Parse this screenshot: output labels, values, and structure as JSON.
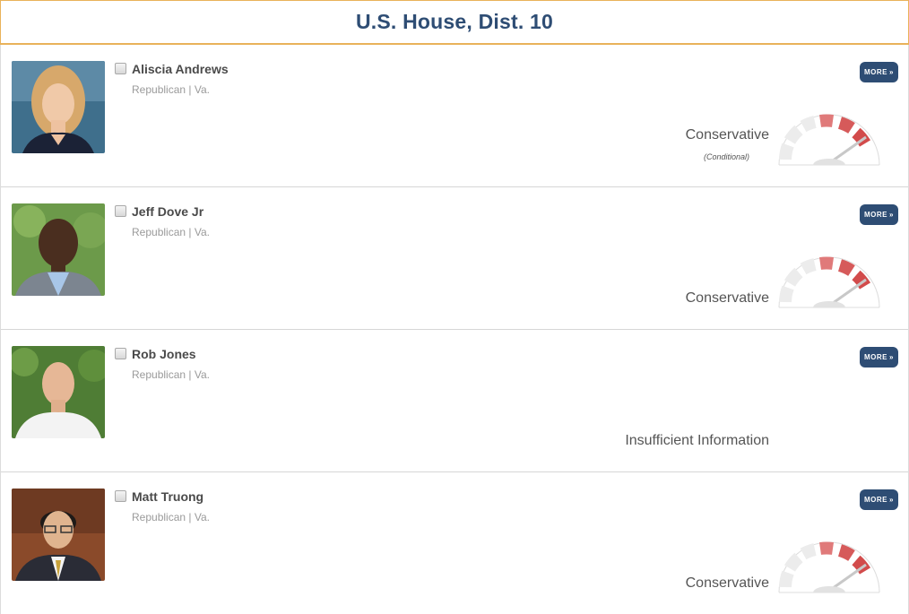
{
  "header": {
    "title": "U.S. House, Dist. 10"
  },
  "more_label": "MORE",
  "colors": {
    "accent": "#2e4d74",
    "border_gold": "#e9b25a",
    "gauge_red_light": "#e07a7a",
    "gauge_red": "#d24b4b",
    "gauge_gray": "#ececec"
  },
  "candidates": [
    {
      "name": "Aliscia Andrews",
      "party": "Republican | Va.",
      "rating": "Conservative",
      "rating_note": "(Conditional)",
      "gauge": true,
      "photo": "woman-blonde-portrait"
    },
    {
      "name": "Jeff Dove Jr",
      "party": "Republican | Va.",
      "rating": "Conservative",
      "rating_note": "",
      "gauge": true,
      "photo": "man-suit-outdoor-portrait"
    },
    {
      "name": "Rob Jones",
      "party": "Republican | Va.",
      "rating": "Insufficient Information",
      "rating_note": "",
      "gauge": false,
      "photo": "man-white-shirt-portrait"
    },
    {
      "name": "Matt Truong",
      "party": "Republican | Va.",
      "rating": "Conservative",
      "rating_note": "",
      "gauge": true,
      "photo": "man-glasses-suit-portrait"
    }
  ]
}
